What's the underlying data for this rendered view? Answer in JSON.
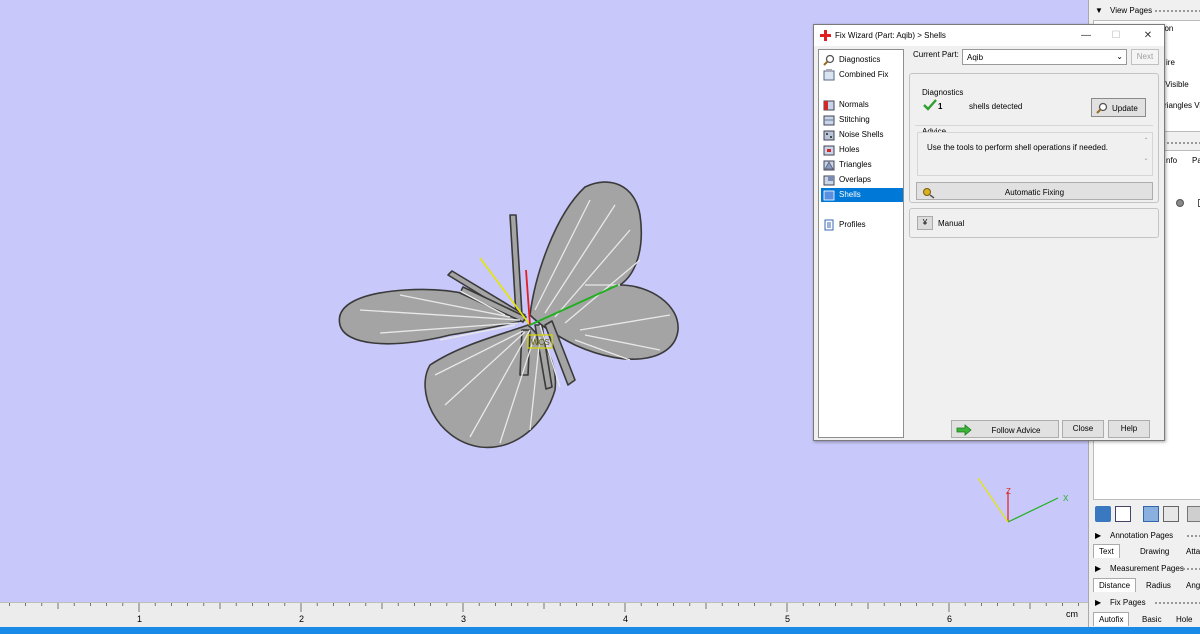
{
  "dialog": {
    "title": "Fix Wizard (Part: Aqib) > Shells",
    "min_glyph": "—",
    "max_glyph": "☐",
    "close_glyph": "✕",
    "nav": {
      "items": [
        {
          "label": "Diagnostics",
          "icon": "magnifier-icon"
        },
        {
          "label": "Combined Fix",
          "icon": "combined-fix-icon"
        },
        {
          "label": "Normals",
          "icon": "normals-cube-icon"
        },
        {
          "label": "Stitching",
          "icon": "stitching-cube-icon"
        },
        {
          "label": "Noise Shells",
          "icon": "noise-shells-cube-icon"
        },
        {
          "label": "Holes",
          "icon": "holes-cube-icon"
        },
        {
          "label": "Triangles",
          "icon": "triangles-cube-icon"
        },
        {
          "label": "Overlaps",
          "icon": "overlaps-cube-icon"
        },
        {
          "label": "Shells",
          "icon": "shells-cube-icon",
          "selected": true
        },
        {
          "label": "Profiles",
          "icon": "profiles-document-icon"
        }
      ]
    },
    "current_part_label": "Current Part:",
    "current_part_value": "Aqib",
    "next_label": "Next",
    "diagnostics_title": "Diagnostics",
    "shell_count": "1",
    "shell_status": "shells detected",
    "update_label": "Update",
    "advice_title": "Advice",
    "advice_text": "Use the tools to perform shell operations if needed.",
    "automatic_fixing_label": "Automatic Fixing",
    "manual_label": "Manual",
    "follow_advice_label": "Follow Advice",
    "close_label": "Close",
    "help_label": "Help"
  },
  "right_panel": {
    "view_pages": "View Pages",
    "list_fragments": [
      "ection",
      "ire",
      "s Visible",
      "riangles Visi"
    ],
    "tab_fragments": [
      "nfo",
      "Pa"
    ],
    "annotation_pages": "Annotation Pages",
    "annotation_tabs": [
      "Text",
      "Drawing",
      "Attac"
    ],
    "measurement_pages": "Measurement Pages",
    "measurement_tabs": [
      "Distance",
      "Radius",
      "Angl"
    ],
    "fix_pages": "Fix Pages",
    "fix_tabs": [
      "Autofix",
      "Basic",
      "Hole"
    ]
  },
  "viewport": {
    "wcs_label": "WCS",
    "axis_labels": {
      "x": "X",
      "y": "Y",
      "z": "Z"
    },
    "ruler_numbers": [
      "1",
      "2",
      "3",
      "4",
      "5",
      "6"
    ],
    "ruler_unit": "cm"
  },
  "colors": {
    "viewport_bg": "#c8c8fa",
    "selection": "#0078d7",
    "status_bar": "#1a8ae8",
    "check_green": "#2e9e2e"
  }
}
